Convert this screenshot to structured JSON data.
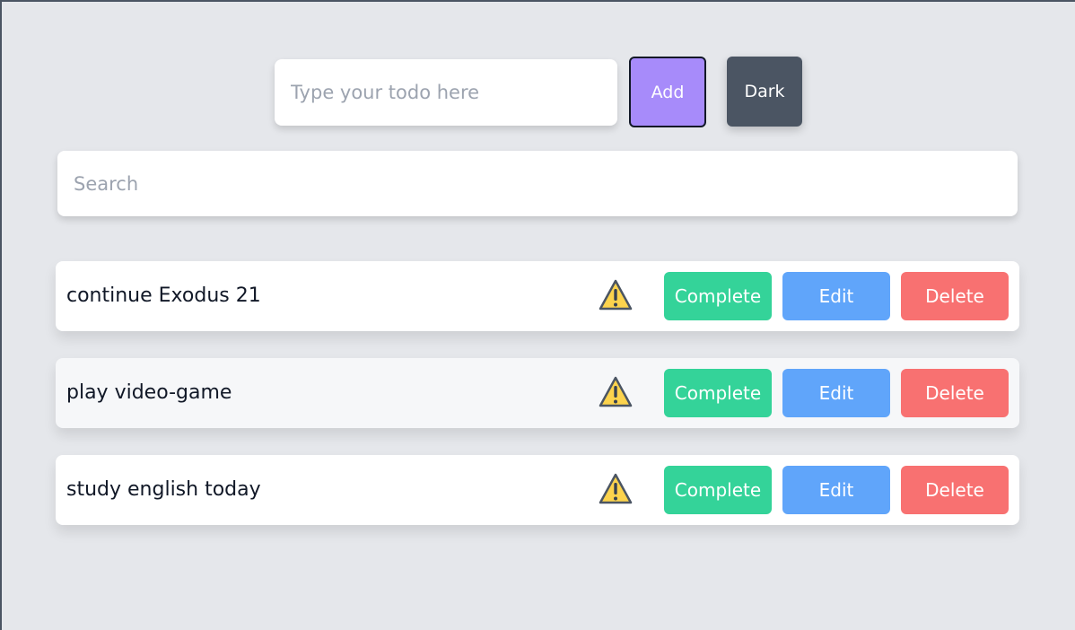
{
  "header": {
    "todo_placeholder": "Type your todo here",
    "add_label": "Add",
    "theme_label": "Dark"
  },
  "search": {
    "placeholder": "Search"
  },
  "todos": [
    {
      "text": "continue Exodus 21",
      "icon": "warning-icon",
      "complete_label": "Complete",
      "edit_label": "Edit",
      "delete_label": "Delete"
    },
    {
      "text": "play video-game",
      "icon": "warning-icon",
      "complete_label": "Complete",
      "edit_label": "Edit",
      "delete_label": "Delete"
    },
    {
      "text": "study english today",
      "icon": "warning-icon",
      "complete_label": "Complete",
      "edit_label": "Edit",
      "delete_label": "Delete"
    }
  ],
  "colors": {
    "background": "#e5e7eb",
    "add_button": "#a78bfa",
    "dark_button": "#4b5563",
    "complete_button": "#34d399",
    "edit_button": "#60a5fa",
    "delete_button": "#f87171",
    "warning": "#fcd34d"
  }
}
